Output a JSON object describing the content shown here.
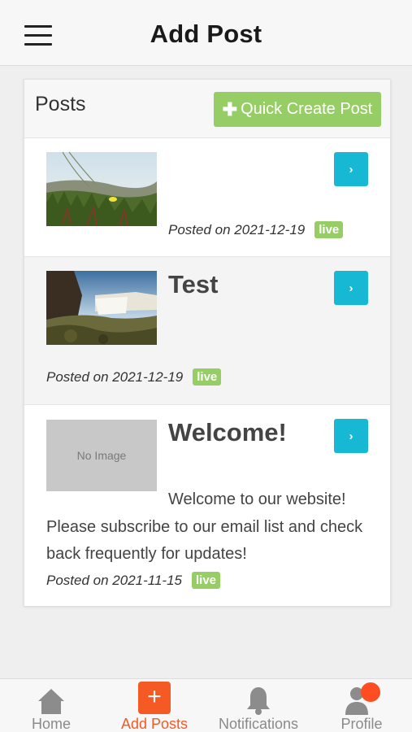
{
  "header": {
    "title": "Add Post"
  },
  "panel": {
    "title": "Posts",
    "quick_create_label": "Quick Create Post"
  },
  "posts": [
    {
      "title": "",
      "image": "meadow",
      "posted": "Posted on 2021-12-19",
      "status": "live",
      "open_label": "›"
    },
    {
      "title": "Test",
      "image": "waterfall",
      "posted": "Posted on 2021-12-19",
      "status": "live",
      "open_label": "›"
    },
    {
      "title": "Welcome!",
      "image": "none",
      "no_image_label": "No Image",
      "excerpt": "Welcome to our website! Please subscribe to our email list and check back frequently for updates!",
      "posted": "Posted on 2021-11-15",
      "status": "live",
      "open_label": "›"
    }
  ],
  "tabs": [
    {
      "label": "Home",
      "icon": "home-icon"
    },
    {
      "label": "Add Posts",
      "icon": "plus-icon",
      "active": true
    },
    {
      "label": "Notifications",
      "icon": "bell-icon"
    },
    {
      "label": "Profile",
      "icon": "users-icon",
      "has_badge": true
    }
  ],
  "colors": {
    "accent_orange": "#f55a24",
    "button_cyan": "#17b8d4",
    "green": "#96cd65",
    "notification_dot": "#ff4d22"
  }
}
